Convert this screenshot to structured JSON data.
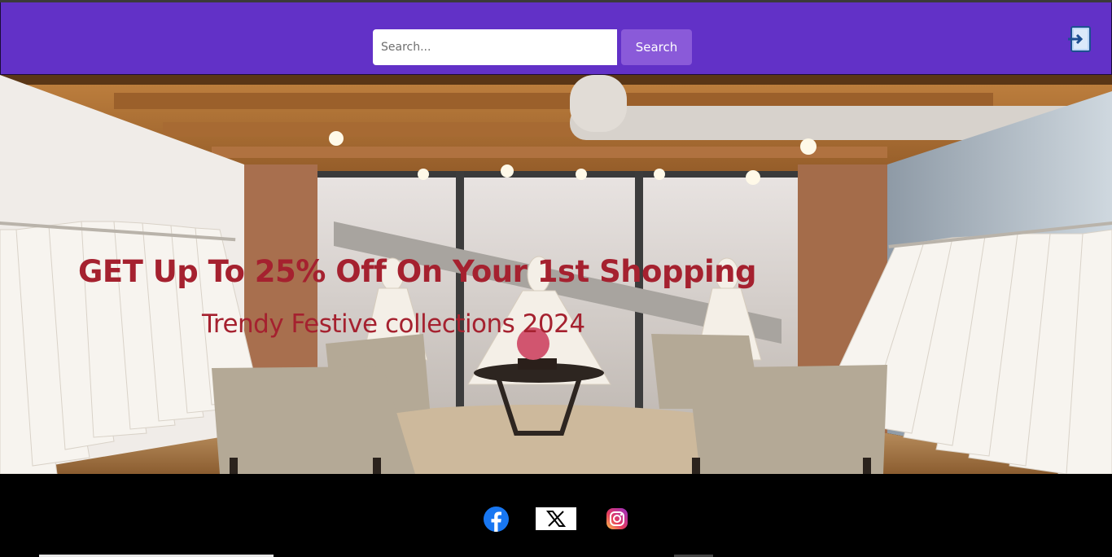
{
  "header": {
    "search_placeholder": "Search...",
    "search_button_label": "Search",
    "login_icon": "login-icon",
    "background_color": "#6231c7"
  },
  "hero": {
    "title": "GET Up To 25% Off On Your 1st Shopping",
    "subtitle": "Trendy Festive collections 2024",
    "text_color": "#a5212f"
  },
  "footer": {
    "social": [
      {
        "name": "Facebook",
        "icon": "facebook-icon"
      },
      {
        "name": "X",
        "icon": "x-twitter-icon"
      },
      {
        "name": "Instagram",
        "icon": "instagram-icon"
      }
    ]
  }
}
